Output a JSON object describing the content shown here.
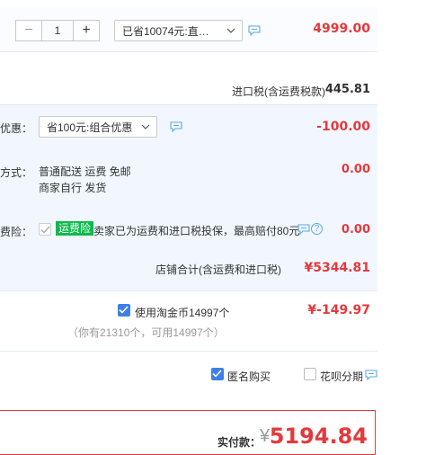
{
  "item": {
    "quantity": "1",
    "minus": "−",
    "plus": "+",
    "promo_select": "已省10074元:直…",
    "price": "4999.00"
  },
  "import_tax": {
    "label": "进口税(含运费税款)",
    "value": "445.81"
  },
  "discount": {
    "label": "优惠：",
    "select": "省100元:组合优惠",
    "value": "-100.00"
  },
  "shipping": {
    "label": "方式：",
    "line1": "普通配送 运费 免邮",
    "line2": "商家自行  发货",
    "value": "0.00"
  },
  "insurance": {
    "label": "费险：",
    "badge": "运费险",
    "text": "卖家已为运费和进口税投保，最高赔付80元",
    "value": "0.00",
    "help": "?"
  },
  "store_total": {
    "label": "店铺合计(含运费和进口税)",
    "value": "¥5344.81"
  },
  "coins": {
    "label": "使用淘金币14997个",
    "value": "¥-149.97",
    "note": "（你有21310个，可用14997个）"
  },
  "options": {
    "anonymous": "匿名购买",
    "huabei": "花呗分期"
  },
  "payment": {
    "label": "实付款：",
    "currency": "¥",
    "value": "5194.84"
  },
  "colors": {
    "accent_red": "#e4393c",
    "checkbox_blue": "#3d7fe8",
    "badge_green": "#0dba4b",
    "chat_blue": "#5aa9e6"
  }
}
